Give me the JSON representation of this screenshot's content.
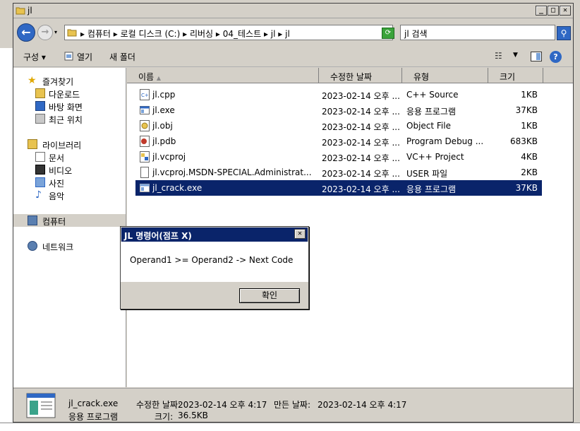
{
  "window": {
    "title": "jl"
  },
  "address": {
    "path": [
      "컴퓨터",
      "로컬 디스크 (C:)",
      "리버싱",
      "04_테스트",
      "jl",
      "jl"
    ],
    "search_placeholder": "jl 검색"
  },
  "toolbar": {
    "organize": "구성 ▾",
    "open": "열기",
    "new_folder": "새 폴더"
  },
  "nav": {
    "favorites": "즐겨찾기",
    "downloads": "다운로드",
    "desktop": "바탕 화면",
    "recent": "최근 위치",
    "libraries": "라이브러리",
    "documents": "문서",
    "videos": "비디오",
    "pictures": "사진",
    "music": "음악",
    "computer": "컴퓨터",
    "network": "네트워크"
  },
  "columns": {
    "name": "이름",
    "modified": "수정한 날짜",
    "type": "유형",
    "size": "크기"
  },
  "files": [
    {
      "name": "jl.cpp",
      "date": "2023-02-14 오후 ...",
      "type": "C++ Source",
      "size": "1KB",
      "icon": "cpp-file-icon"
    },
    {
      "name": "jl.exe",
      "date": "2023-02-14 오후 ...",
      "type": "응용 프로그램",
      "size": "37KB",
      "icon": "exe-file-icon"
    },
    {
      "name": "jl.obj",
      "date": "2023-02-14 오후 ...",
      "type": "Object File",
      "size": "1KB",
      "icon": "obj-file-icon"
    },
    {
      "name": "jl.pdb",
      "date": "2023-02-14 오후 ...",
      "type": "Program Debug ...",
      "size": "683KB",
      "icon": "pdb-file-icon"
    },
    {
      "name": "jl.vcproj",
      "date": "2023-02-14 오후 ...",
      "type": "VC++ Project",
      "size": "4KB",
      "icon": "vcproj-file-icon"
    },
    {
      "name": "jl.vcproj.MSDN-SPECIAL.Administrat...",
      "date": "2023-02-14 오후 ...",
      "type": "USER 파일",
      "size": "2KB",
      "icon": "user-file-icon"
    },
    {
      "name": "jl_crack.exe",
      "date": "2023-02-14 오후 ...",
      "type": "응용 프로그램",
      "size": "37KB",
      "icon": "exe-file-icon",
      "selected": true
    }
  ],
  "status": {
    "filename": "jl_crack.exe",
    "modified_label": "수정한 날짜:",
    "modified_value": "2023-02-14 오후 4:17",
    "created_label": "만든 날짜:",
    "created_value": "2023-02-14 오후 4:17",
    "type": "응용 프로그램",
    "size_label": "크기:",
    "size_value": "36.5KB"
  },
  "dialog": {
    "title": "JL 명령어(점프 X)",
    "message": "Operand1 >= Operand2 -> Next Code",
    "ok": "확인"
  },
  "colors": {
    "selection": "#0a246a",
    "dialog_title": "#0a246a"
  }
}
